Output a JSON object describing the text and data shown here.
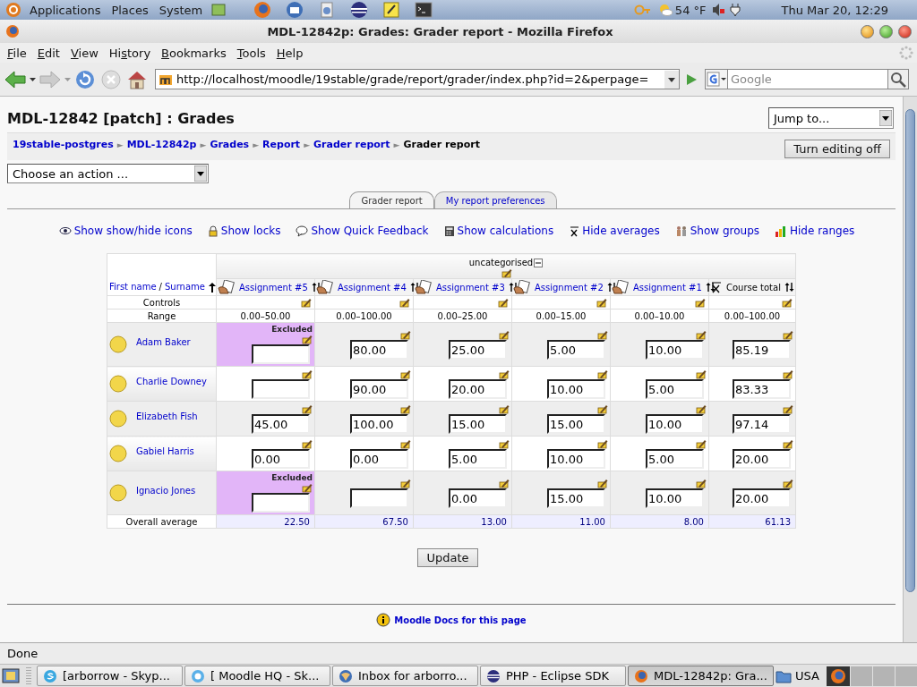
{
  "desktop_panel": {
    "menus": [
      "Applications",
      "Places",
      "System"
    ],
    "weather": "54 °F",
    "clock": "Thu Mar 20, 12:29"
  },
  "window": {
    "title": "MDL-12842p: Grades: Grader report - Mozilla Firefox"
  },
  "menu_bar": [
    {
      "key": "F",
      "after": "ile"
    },
    {
      "key": "E",
      "after": "dit"
    },
    {
      "key": "V",
      "after": "iew"
    },
    {
      "before": "Hi",
      "key": "s",
      "after": "tory"
    },
    {
      "key": "B",
      "after": "ookmarks"
    },
    {
      "key": "T",
      "after": "ools"
    },
    {
      "key": "H",
      "after": "elp"
    }
  ],
  "navigation": {
    "url": "http://localhost/moodle/19stable/grade/report/grader/index.php?id=2&perpage=",
    "search_placeholder": "Google"
  },
  "page": {
    "heading": "MDL-12842 [patch] : Grades",
    "jump_menu": "Jump to...",
    "breadcrumb": {
      "separator": "►",
      "items": [
        {
          "label": "19stable-postgres",
          "link": true
        },
        {
          "label": "MDL-12842p",
          "link": true
        },
        {
          "label": "Grades",
          "link": true
        },
        {
          "label": "Report",
          "link": true
        },
        {
          "label": "Grader report",
          "link": true
        },
        {
          "label": "Grader report",
          "link": false
        }
      ]
    },
    "editing_button": "Turn editing off",
    "action_menu": "Choose an action ...",
    "tabs": [
      {
        "label": "Grader report",
        "selected": true
      },
      {
        "label": "My report preferences",
        "selected": false
      }
    ],
    "toggles": [
      {
        "kind": "eye",
        "label": "Show show/hide icons"
      },
      {
        "kind": "lock",
        "label": "Show locks"
      },
      {
        "kind": "feedback",
        "label": "Show Quick Feedback"
      },
      {
        "kind": "calculator",
        "label": "Show calculations"
      },
      {
        "kind": "average",
        "label": "Hide averages"
      },
      {
        "kind": "groups",
        "label": "Show groups"
      },
      {
        "kind": "ranges",
        "label": "Hide ranges"
      }
    ],
    "table": {
      "category": "uncategorised",
      "name_header": {
        "first": "First name",
        "divider": "/",
        "last": "Surname"
      },
      "columns": [
        {
          "kind": "assignment",
          "label": "Assignment #5"
        },
        {
          "kind": "assignment",
          "label": "Assignment #4"
        },
        {
          "kind": "assignment",
          "label": "Assignment #3"
        },
        {
          "kind": "assignment",
          "label": "Assignment #2"
        },
        {
          "kind": "assignment",
          "label": "Assignment #1"
        },
        {
          "kind": "total",
          "label": "Course total"
        }
      ],
      "controls_label": "Controls",
      "range_label": "Range",
      "ranges": [
        "0.00–50.00",
        "0.00–100.00",
        "0.00–25.00",
        "0.00–15.00",
        "0.00–10.00",
        "0.00–100.00"
      ],
      "students": [
        {
          "name": "Adam Baker",
          "grades": [
            {
              "excluded": true,
              "label": "Excluded"
            },
            {
              "value": "80.00",
              "excluded": false
            },
            {
              "value": "25.00",
              "excluded": false
            },
            {
              "value": "5.00",
              "excluded": false
            },
            {
              "value": "10.00",
              "excluded": false
            },
            {
              "value": "85.19",
              "excluded": false
            }
          ]
        },
        {
          "name": "Charlie Downey",
          "grades": [
            {
              "excluded": false
            },
            {
              "value": "90.00",
              "excluded": false
            },
            {
              "value": "20.00",
              "excluded": false
            },
            {
              "value": "10.00",
              "excluded": false
            },
            {
              "value": "5.00",
              "excluded": false
            },
            {
              "value": "83.33",
              "excluded": false
            }
          ]
        },
        {
          "name": "Elizabeth Fish",
          "grades": [
            {
              "value": "45.00",
              "excluded": false
            },
            {
              "value": "100.00",
              "excluded": false
            },
            {
              "value": "15.00",
              "excluded": false
            },
            {
              "value": "15.00",
              "excluded": false
            },
            {
              "value": "10.00",
              "excluded": false
            },
            {
              "value": "97.14",
              "excluded": false
            }
          ]
        },
        {
          "name": "Gabiel Harris",
          "grades": [
            {
              "value": "0.00",
              "excluded": false
            },
            {
              "value": "0.00",
              "excluded": false
            },
            {
              "value": "5.00",
              "excluded": false
            },
            {
              "value": "10.00",
              "excluded": false
            },
            {
              "value": "5.00",
              "excluded": false
            },
            {
              "value": "20.00",
              "excluded": false
            }
          ]
        },
        {
          "name": "Ignacio Jones",
          "grades": [
            {
              "excluded": true,
              "label": "Excluded"
            },
            {
              "excluded": false
            },
            {
              "value": "0.00",
              "excluded": false
            },
            {
              "value": "15.00",
              "excluded": false
            },
            {
              "value": "10.00",
              "excluded": false
            },
            {
              "value": "20.00",
              "excluded": false
            }
          ]
        }
      ],
      "average": {
        "label": "Overall average",
        "values": [
          "22.50",
          "67.50",
          "13.00",
          "11.00",
          "8.00",
          "61.13"
        ]
      }
    },
    "update_button": "Update",
    "docs_link": "Moodle Docs for this page"
  },
  "status_bar": "Done",
  "taskbar": {
    "items": [
      {
        "label": "[arborrow - Skyp...",
        "selected": false
      },
      {
        "label": "[ Moodle HQ - Sk...",
        "selected": false
      },
      {
        "label": "Inbox for arborro...",
        "selected": false
      },
      {
        "label": "PHP - Eclipse SDK",
        "selected": false
      },
      {
        "label": "MDL-12842p: Gra...",
        "selected": true
      }
    ],
    "keyboard": "USA"
  }
}
